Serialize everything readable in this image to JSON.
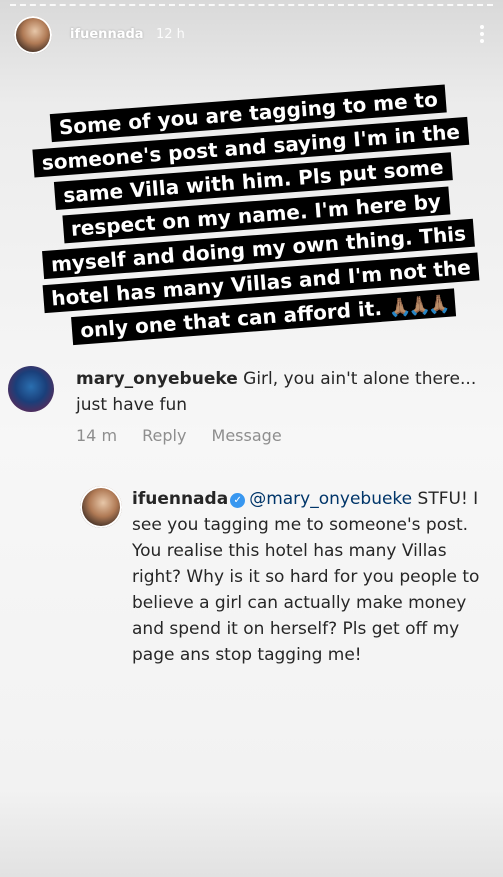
{
  "story": {
    "username": "ifuennada",
    "time": "12 h",
    "caption_lines": [
      "Some of you are tagging to me to",
      "someone's post and saying I'm in the",
      "same Villa with him. Pls put some",
      "respect on my name. I'm here by",
      "myself and doing my own thing. This",
      "hotel has many Villas and I'm not the",
      "only one that can afford it."
    ],
    "caption_emoji": "🙏🏽🙏🏽🙏🏽"
  },
  "comment": {
    "username": "mary_onyebueke",
    "text": "Girl, you ain't alone there... just have fun",
    "time": "14 m",
    "reply_label": "Reply",
    "message_label": "Message"
  },
  "reply": {
    "username": "ifuennada",
    "verified_icon": "verified-badge-icon",
    "mention": "@mary_onyebueke",
    "text": "STFU! I see you tagging me to someone's post. You realise this hotel has many Villas right? Why is it so hard for you people to believe a girl can actually make money and spend it on herself? Pls get off my page ans stop tagging me!"
  },
  "colors": {
    "caption_bg": "#000000",
    "caption_text": "#ffffff",
    "verified": "#3897f0",
    "meta": "#8e8e8e"
  }
}
